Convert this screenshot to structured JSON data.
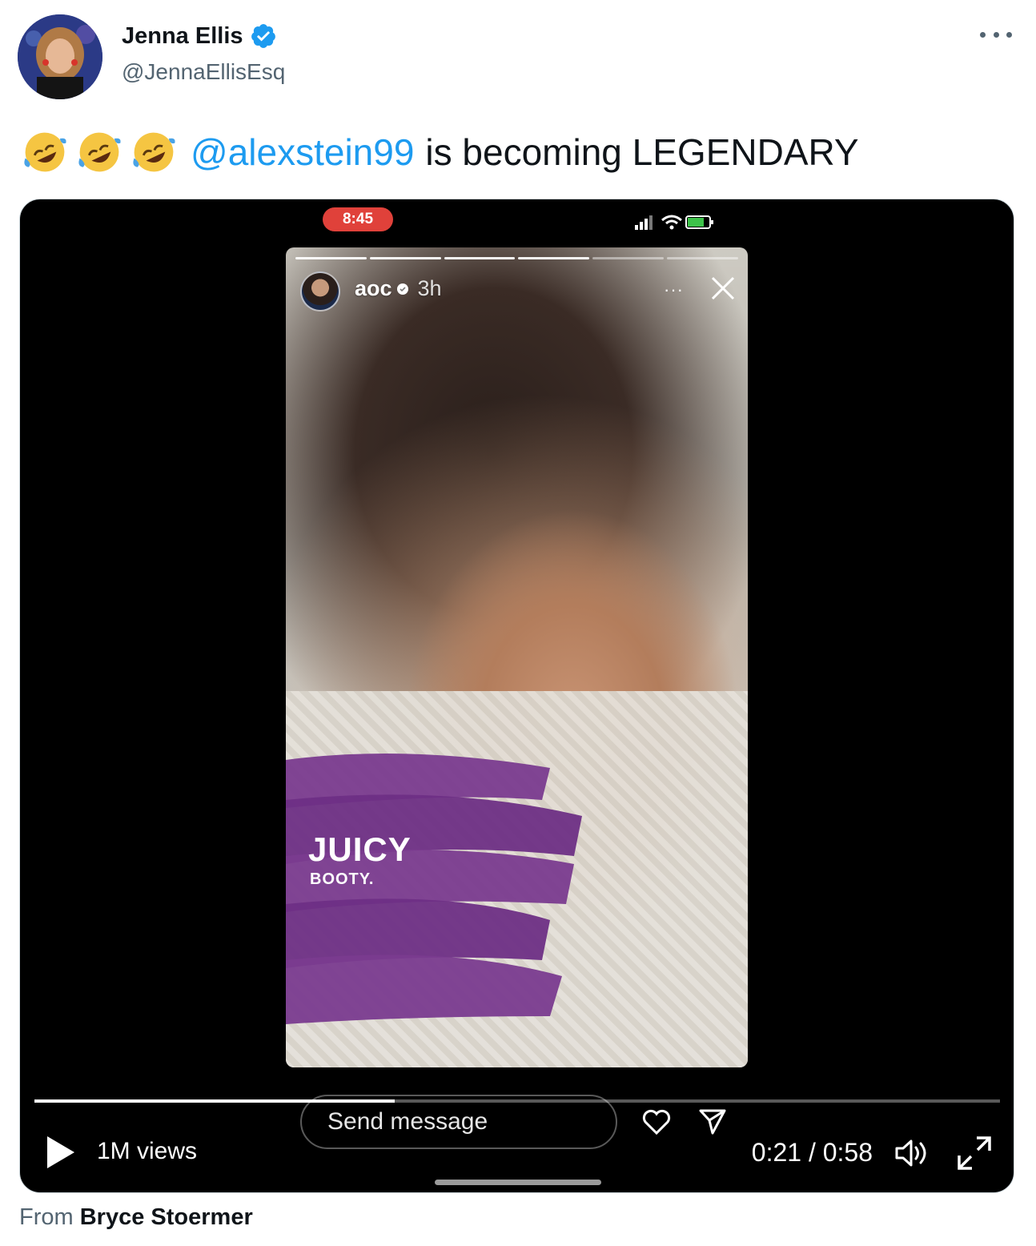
{
  "author": {
    "display_name": "Jenna Ellis",
    "handle": "@JennaEllisEsq",
    "verified": true
  },
  "tweet": {
    "emoji": [
      "rolling-on-floor-laughing",
      "rolling-on-floor-laughing",
      "rolling-on-floor-laughing"
    ],
    "mention": "@alexstein99",
    "text": "is becoming LEGENDARY"
  },
  "video": {
    "status_time": "8:45",
    "story": {
      "username": "aoc",
      "age": "3h",
      "more": "···",
      "caption_large": "JUICY",
      "caption_small": "BOOTY.",
      "send_message": "Send message"
    },
    "views": "1M views",
    "time_display": "0:21 / 0:58",
    "progress": 0.373
  },
  "footer": {
    "from_prefix": "From",
    "from_name": "Bryce Stoermer"
  },
  "colors": {
    "link": "#1d9bf0",
    "secondary_text": "#536471",
    "verified": "#1d9bf0",
    "paint": "#7a3b8f"
  }
}
